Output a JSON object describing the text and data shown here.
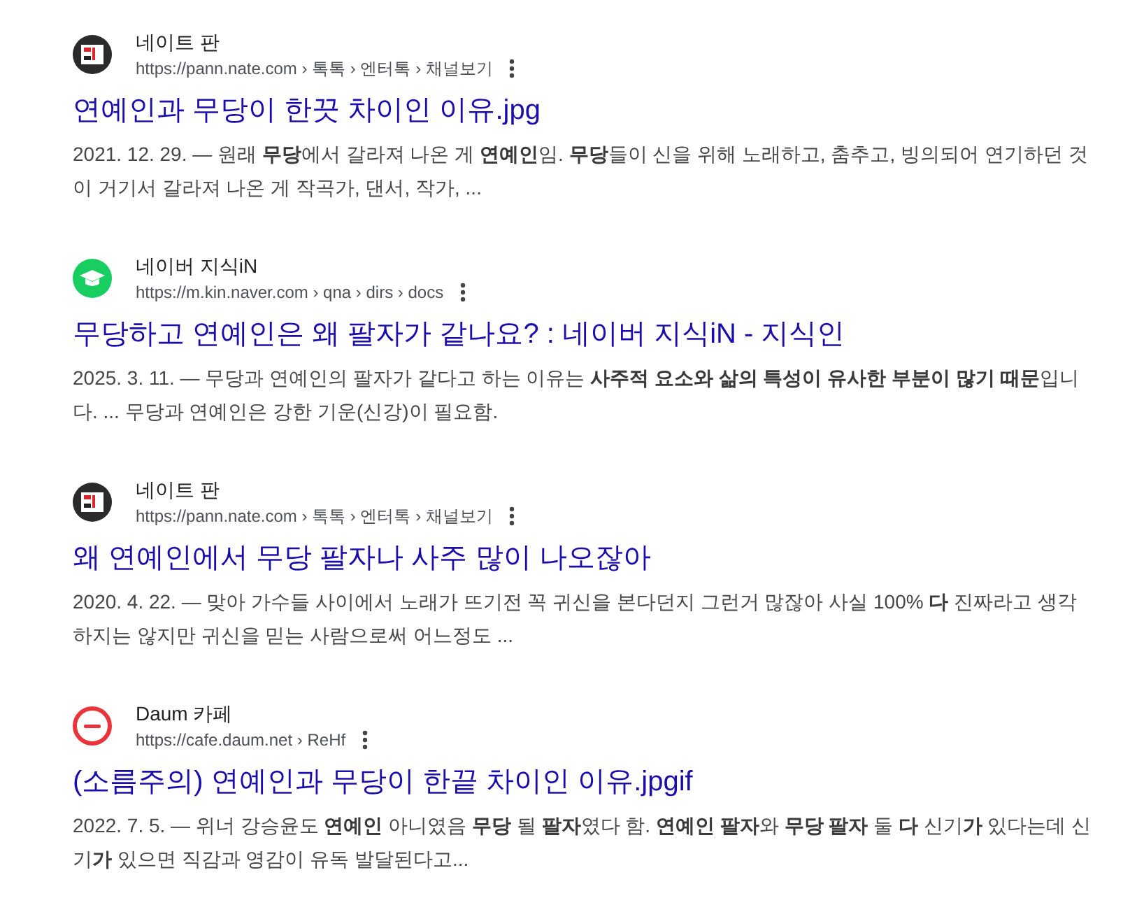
{
  "results": [
    {
      "favicon": {
        "kind": "nate"
      },
      "site": "네이트 판",
      "url": "https://pann.nate.com › 톡톡 › 엔터톡 › 채널보기",
      "title": "연예인과 무당이 한끗 차이인 이유.jpg",
      "snippet": "2021. 12. 29. — 원래 **무당**에서 갈라져 나온 게 **연예인**임. **무당**들이 신을 위해 노래하고, 춤추고, 빙의되어 연기하던 것이 거기서 갈라져 나온 게 작곡가, 댄서, 작가, ..."
    },
    {
      "favicon": {
        "kind": "naver"
      },
      "site": "네이버 지식iN",
      "url": "https://m.kin.naver.com › qna › dirs › docs",
      "title": "무당하고 연예인은 왜 팔자가 같나요? : 네이버 지식iN - 지식인",
      "snippet": "2025. 3. 11. — 무당과 연예인의 팔자가 같다고 하는 이유는 **사주적 요소와 삶의 특성이 유사한 부분이 많기 때문**입니다. ... 무당과 연예인은 강한 기운(신강)이 필요함."
    },
    {
      "favicon": {
        "kind": "nate"
      },
      "site": "네이트 판",
      "url": "https://pann.nate.com › 톡톡 › 엔터톡 › 채널보기",
      "title": "왜 연예인에서 무당 팔자나 사주 많이 나오잖아",
      "snippet": "2020. 4. 22. — 맞아 가수들 사이에서 노래가 뜨기전 꼭 귀신을 본다던지 그런거 많잖아 사실 100% **다** 진짜라고 생각 하지는 않지만 귀신을 믿는 사람으로써 어느정도 ..."
    },
    {
      "favicon": {
        "kind": "daum"
      },
      "site": "Daum 카페",
      "url": "https://cafe.daum.net › ReHf",
      "title": "(소름주의) 연예인과 무당이 한끝 차이인 이유.jpgif",
      "snippet": "2022. 7. 5. — 위너 강승윤도 **연예인** 아니였음 **무당** 될 **팔자**였다 함. **연예인 팔자**와 **무당 팔자** 둘 **다** 신기**가** 있다는데 신기**가** 있으면 직감과 영감이 유독 발달된다고..."
    }
  ]
}
